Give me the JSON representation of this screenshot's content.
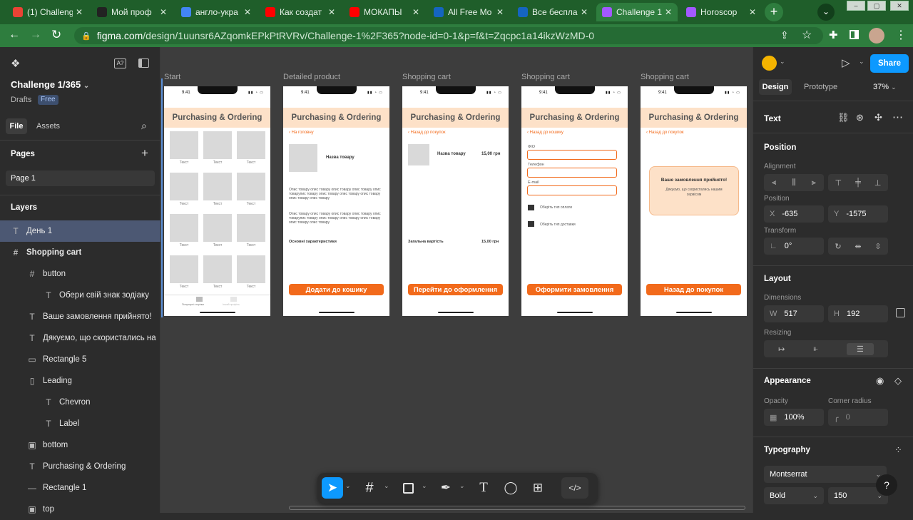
{
  "browser": {
    "tabs": [
      {
        "title": "(1) Challeng",
        "color": "#ea4335"
      },
      {
        "title": "Мой проф",
        "color": "#222222"
      },
      {
        "title": "англо-укра",
        "color": "#4285f4"
      },
      {
        "title": "Как создат",
        "color": "#ff0000"
      },
      {
        "title": "МОКАПЫ",
        "color": "#ff0000"
      },
      {
        "title": "All Free Mo",
        "color": "#1565c0"
      },
      {
        "title": "Все беспла",
        "color": "#1565c0"
      },
      {
        "title": "Challenge 1",
        "color": "#a259ff"
      },
      {
        "title": "Horoscop",
        "color": "#a259ff"
      }
    ],
    "url_host": "figma.com",
    "url_rest": "/design/1uunsr6AZqomkEPkPtRVRv/Challenge-1%2F365?node-id=0-1&p=f&t=Zqcpc1a14ikzWzMD-0"
  },
  "left": {
    "file_title": "Challenge 1/365",
    "drafts": "Drafts",
    "plan_badge": "Free",
    "tab_file": "File",
    "tab_assets": "Assets",
    "pages_label": "Pages",
    "page1": "Page 1",
    "layers_label": "Layers",
    "layers": [
      {
        "icon": "T",
        "name": "День 1",
        "indent": 0,
        "selected": true
      },
      {
        "icon": "#",
        "name": "Shopping cart",
        "indent": 0,
        "bold": true
      },
      {
        "icon": "#",
        "name": "button",
        "indent": 1
      },
      {
        "icon": "T",
        "name": "Обери свій знак зодіаку",
        "indent": 2
      },
      {
        "icon": "T",
        "name": "Ваше замовлення прийнято!",
        "indent": 1
      },
      {
        "icon": "T",
        "name": "Дякуємо, що скористались на",
        "indent": 1
      },
      {
        "icon": "▭",
        "name": "Rectangle 5",
        "indent": 1
      },
      {
        "icon": "▯",
        "name": "Leading",
        "indent": 1
      },
      {
        "icon": "T",
        "name": "Chevron",
        "indent": 2
      },
      {
        "icon": "T",
        "name": "Label",
        "indent": 2
      },
      {
        "icon": "▣",
        "name": "bottom",
        "indent": 1
      },
      {
        "icon": "T",
        "name": "Purchasing & Ordering",
        "indent": 1
      },
      {
        "icon": "—",
        "name": "Rectangle 1",
        "indent": 1
      },
      {
        "icon": "▣",
        "name": "top",
        "indent": 1
      }
    ]
  },
  "canvas": {
    "frames": [
      {
        "label": "Start"
      },
      {
        "label": "Detailed product"
      },
      {
        "label": "Shopping cart"
      },
      {
        "label": "Shopping cart"
      },
      {
        "label": "Shopping cart"
      }
    ],
    "time": "9:41",
    "header": "Purchasing & Ordering",
    "grid_text": "Текст",
    "tabbar_left": "Популярні сторінки",
    "tabbar_right": "Інший профіль",
    "p2": {
      "back": "На головну",
      "name": "Назва товару",
      "desc1": "Опис товару опис товару опис товару опис товару опис товарупис товару опис товару опис товару опис товару опис товару опис товару",
      "desc2": "Опис товару опис товару опис товару опис товару опис товарупис товару опис товару опис товару опис товару опис товару опис товару",
      "specs": "Основні характеристики",
      "button": "Додати до кошику"
    },
    "p3": {
      "back": "Назад до покупок",
      "name": "Назва товару",
      "price": "15,00 грн",
      "total_label": "Загальна вартість",
      "total": "15,00 грн",
      "button": "Перейти до оформлення"
    },
    "p4": {
      "back": "Назад до кошику",
      "f1": "ФІО",
      "f2": "Телефон",
      "f3": "E-mail",
      "c1": "Оберіть тип оплати",
      "c2": "Оберіть тип доставки",
      "button": "Оформити замовлення"
    },
    "p5": {
      "back": "Назад до покупок",
      "title": "Ваше замовлення прийнято!",
      "thanks": "Дякуємо, що скористались нашим сервісом",
      "button": "Назад до покупок"
    }
  },
  "right": {
    "share": "Share",
    "tab_design": "Design",
    "tab_prototype": "Prototype",
    "zoom": "37%",
    "section_text": "Text",
    "position_title": "Position",
    "alignment": "Alignment",
    "position": "Position",
    "x_key": "X",
    "x": "-635",
    "y_key": "Y",
    "y": "-1575",
    "transform": "Transform",
    "rotation": "0°",
    "layout": "Layout",
    "dimensions": "Dimensions",
    "w_key": "W",
    "w": "517",
    "h_key": "H",
    "h": "192",
    "resizing": "Resizing",
    "appearance": "Appearance",
    "opacity_label": "Opacity",
    "opacity": "100%",
    "radius_label": "Corner radius",
    "radius": "0",
    "typography": "Typography",
    "font": "Montserrat",
    "weight": "Bold",
    "size": "150",
    "help": "?"
  }
}
